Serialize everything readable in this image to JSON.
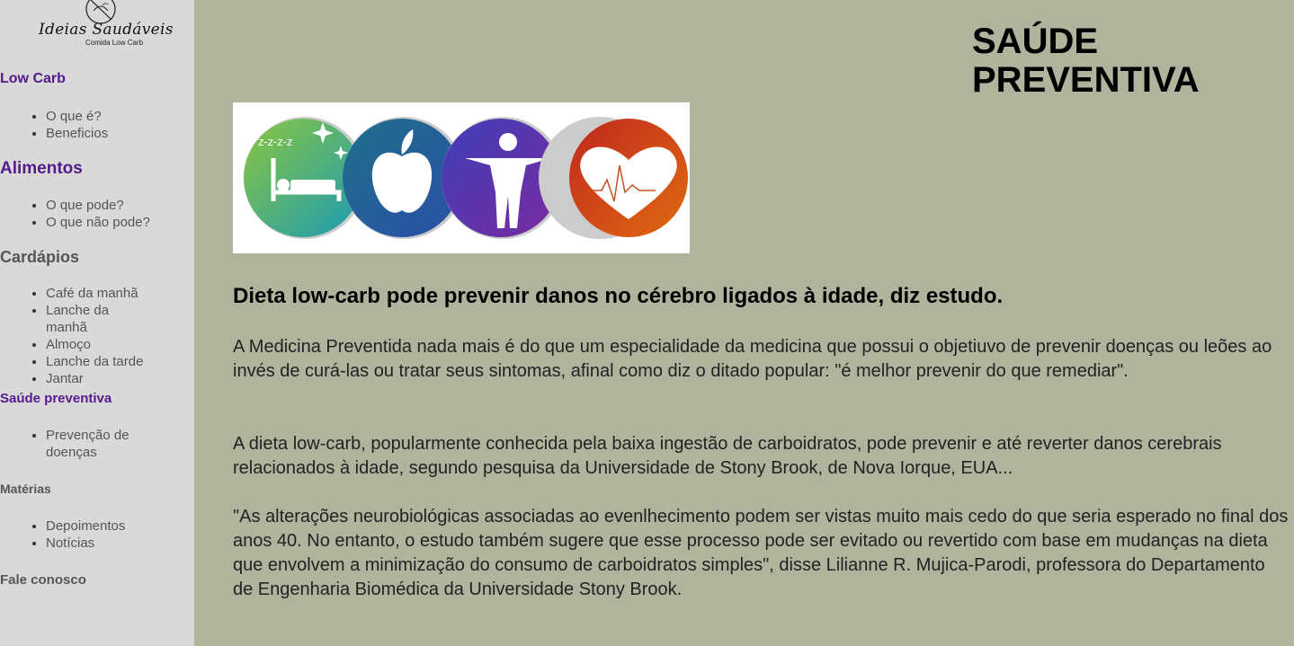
{
  "logo": {
    "brand": "Ideias Saudáveis",
    "tagline": "Comida Low Carb",
    "icon": "no-bread-icon"
  },
  "sidebar": {
    "sections": [
      {
        "title": "Low Carb",
        "items": [
          "O que é?",
          "Beneficios"
        ]
      },
      {
        "title": "Alimentos",
        "items": [
          "O que pode?",
          "O que não pode?"
        ]
      },
      {
        "title": "Cardápios",
        "items": [
          "Café da manhã",
          "Lanche da manhã",
          "Almoço",
          "Lanche da tarde",
          "Jantar"
        ]
      },
      {
        "title": "Saúde preventiva",
        "items": [
          "Prevenção de doenças"
        ]
      },
      {
        "title": "Matérias",
        "items": [
          "Depoimentos",
          "Notícias"
        ]
      },
      {
        "title": "Fale conosco",
        "items": []
      }
    ]
  },
  "main": {
    "title_line1": "SAÚDE",
    "title_line2": "PREVENTIVA",
    "hero_icons": [
      "sleep-icon",
      "apple-icon",
      "person-icon",
      "heart-icon"
    ],
    "heading": "Dieta low-carb pode prevenir danos no cérebro ligados à idade, diz estudo.",
    "paragraphs": [
      "A Medicina Preventida nada mais é do que um especialidade da medicina que possui o objetiuvo de prevenir doenças ou leões ao invés de curá-las ou tratar seus sintomas, afinal como diz o ditado popular: \"é melhor prevenir do que remediar\".",
      "A dieta low-carb, popularmente conhecida pela baixa ingestão de carboidratos, pode prevenir e até reverter danos cerebrais relacionados à idade, segundo pesquisa da Universidade de Stony Brook, de Nova Iorque, EUA...",
      "\"As alterações neurobiológicas associadas ao evenlhecimento podem ser vistas muito mais cedo do que seria esperado no final dos anos 40. No entanto, o estudo também sugere que esse processo pode ser evitado ou revertido com base em mudanças na dieta que envolvem a minimização do consumo de carboidratos simples\", disse Lilianne R. Mujica-Parodi, professora do Departamento de Engenharia Biomédica da Universidade Stony Brook."
    ]
  },
  "colors": {
    "page_bg": "#b0b49c",
    "sidebar_bg": "#d9d9d9",
    "link_visited": "#551a8b",
    "nav_gray": "#555555"
  }
}
